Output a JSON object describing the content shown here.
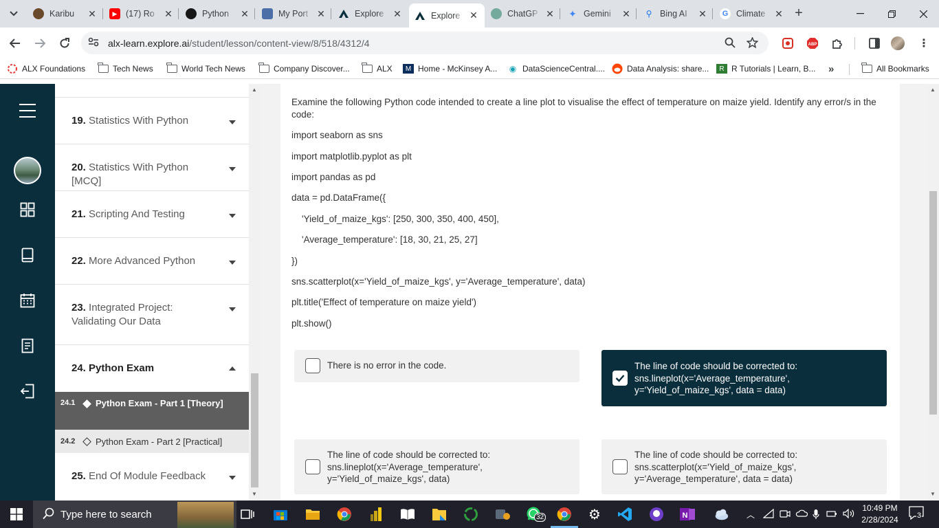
{
  "browser": {
    "tabs": [
      {
        "label": "Karibu",
        "favicon": "karibu-icon",
        "color": "#6b4a2b"
      },
      {
        "label": "(17) Ro",
        "favicon": "youtube-icon",
        "color": "#ff0000"
      },
      {
        "label": "Python",
        "favicon": "github-icon",
        "color": "#181717"
      },
      {
        "label": "My Port",
        "favicon": "portfolio-icon",
        "color": "#4b6fa6"
      },
      {
        "label": "Explore",
        "favicon": "explore-ai-icon",
        "color": "#0b2e3c"
      },
      {
        "label": "Explore",
        "favicon": "explore-ai-icon",
        "color": "#0b2e3c"
      },
      {
        "label": "ChatGP",
        "favicon": "chatgpt-icon",
        "color": "#74aa9c"
      },
      {
        "label": "Gemini",
        "favicon": "gemini-icon",
        "color": "#4285f4"
      },
      {
        "label": "Bing AI",
        "favicon": "bing-icon",
        "color": "#1a73e8"
      },
      {
        "label": "Climate",
        "favicon": "google-icon",
        "color": "#4285f4"
      }
    ],
    "active_tab_index": 5,
    "url_host": "alx-learn.explore.ai",
    "url_path": "/student/lesson/content-view/8/518/4312/4",
    "bookmarks": [
      {
        "label": "ALX Foundations",
        "icon": "alx-icon"
      },
      {
        "label": "Tech News",
        "icon": "folder-icon"
      },
      {
        "label": "World Tech News",
        "icon": "folder-icon"
      },
      {
        "label": "Company Discover...",
        "icon": "folder-icon"
      },
      {
        "label": "ALX",
        "icon": "folder-icon"
      },
      {
        "label": "Home - McKinsey A...",
        "icon": "mckinsey-icon"
      },
      {
        "label": "DataScienceCentral....",
        "icon": "dsc-icon"
      },
      {
        "label": "Data Analysis: share...",
        "icon": "reddit-icon"
      },
      {
        "label": "R Tutorials | Learn, B...",
        "icon": "r-tutorials-icon"
      }
    ],
    "bookmarks_overflow": "»",
    "all_bookmarks": "All Bookmarks"
  },
  "sidebar": {
    "modules": [
      {
        "num": "19.",
        "title": "Statistics With Python"
      },
      {
        "num": "20.",
        "title": "Statistics With Python [MCQ]"
      },
      {
        "num": "21.",
        "title": "Scripting And Testing"
      },
      {
        "num": "22.",
        "title": "More Advanced Python"
      },
      {
        "num": "23.",
        "title": "Integrated Project: Validating Our Data"
      },
      {
        "num": "24.",
        "title": "Python Exam"
      },
      {
        "num": "25.",
        "title": "End Of Module Feedback"
      }
    ],
    "sub_items": [
      {
        "num": "24.1",
        "title": "Python Exam - Part 1 [Theory]"
      },
      {
        "num": "24.2",
        "title": "Python Exam - Part 2 [Practical]"
      }
    ]
  },
  "question": {
    "prompt": "Examine the following Python code intended to create a line plot to visualise the effect of temperature on maize yield. Identify any error/s in the code:",
    "code": [
      "import seaborn as sns",
      "import matplotlib.pyplot as plt",
      "import pandas as pd",
      "data = pd.DataFrame({",
      "    'Yield_of_maize_kgs': [250, 300, 350, 400, 450],",
      "    'Average_temperature': [18, 30, 21, 25, 27]",
      "})",
      "sns.scatterplot(x='Yield_of_maize_kgs', y='Average_temperature', data)",
      "plt.title('Effect of temperature on maize yield')",
      "plt.show()"
    ],
    "options": [
      {
        "lines": [
          "There is no error in the code."
        ],
        "checked": false
      },
      {
        "lines": [
          "The line of code should be corrected to:",
          "sns.lineplot(x='Average_temperature',",
          "y='Yield_of_maize_kgs', data = data)"
        ],
        "checked": true
      },
      {
        "lines": [
          "The line of code should be corrected to:",
          "sns.lineplot(x='Average_temperature',",
          "y='Yield_of_maize_kgs', data)"
        ],
        "checked": false
      },
      {
        "lines": [
          "The line of code should be corrected to:",
          "sns.scatterplot(x='Yield_of_maize_kgs',",
          "y='Average_temperature', data = data)"
        ],
        "checked": false
      }
    ]
  },
  "taskbar": {
    "search_placeholder": "Type here to search",
    "whatsapp_badge": "32",
    "time": "10:49 PM",
    "date": "2/28/2024",
    "notifications": "3"
  },
  "colors": {
    "rail": "#0b2e3c",
    "selected_option": "#0b2e3c",
    "active_subitem": "#5e5e5e"
  }
}
